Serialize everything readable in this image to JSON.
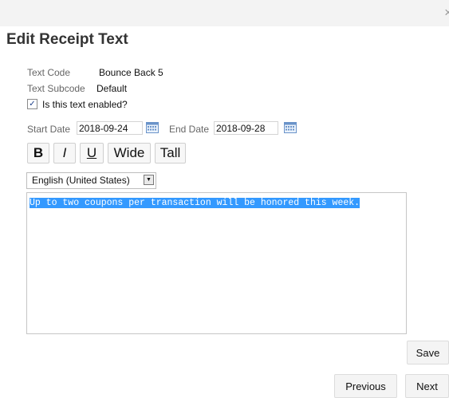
{
  "window": {
    "close_glyph": "×"
  },
  "dialog": {
    "title": "Edit Receipt Text"
  },
  "fields": {
    "text_code_label": "Text Code",
    "text_code_value": "Bounce Back 5",
    "text_subcode_label": "Text Subcode",
    "text_subcode_value": "Default",
    "enabled_label": "Is this text enabled?",
    "enabled_checked": true,
    "start_date_label": "Start Date",
    "start_date_value": "2018-09-24",
    "end_date_label": "End Date",
    "end_date_value": "2018-09-28"
  },
  "toolbar": {
    "bold_label": "B",
    "italic_label": "I",
    "underline_label": "U",
    "wide_label": "Wide",
    "tall_label": "Tall"
  },
  "language": {
    "selected": "English (United States)"
  },
  "editor": {
    "text": "Up to two coupons per transaction will be honored this week."
  },
  "buttons": {
    "save": "Save",
    "previous": "Previous",
    "next": "Next"
  },
  "icons": {
    "calendar": "calendar-icon",
    "close": "close-icon",
    "checkbox": "checkmark-icon",
    "dropdown": "chevron-down-icon"
  },
  "colors": {
    "selection": "#3399ff",
    "titlebar": "#f3f3f3"
  }
}
